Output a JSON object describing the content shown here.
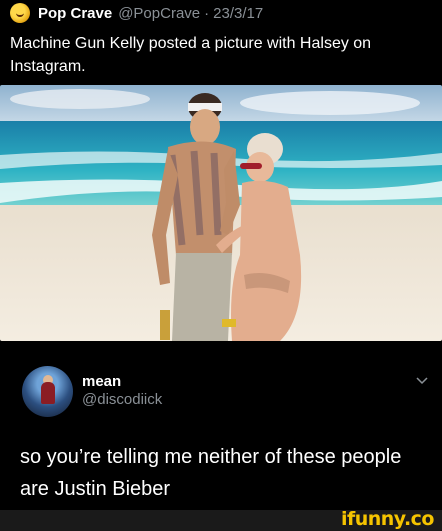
{
  "tweet": {
    "author_name": "Pop Crave",
    "author_handle": "@PopCrave",
    "separator": "·",
    "date": "23/3/17",
    "text": "Machine Gun Kelly posted a picture with Halsey on Instagram.",
    "avatar_icon": "pop-crave-avatar-icon"
  },
  "photo": {
    "description_icon": "beach-photo-image"
  },
  "reply": {
    "author_name": "mean",
    "author_handle": "@discodiick",
    "text": "so you’re telling me neither of these people are Justin Bieber",
    "menu_icon": "chevron-down-icon"
  },
  "watermark": {
    "text": "ifunny.co",
    "color": "#f5c400"
  },
  "colors": {
    "background": "#000000",
    "secondary_text": "#8a9096"
  }
}
